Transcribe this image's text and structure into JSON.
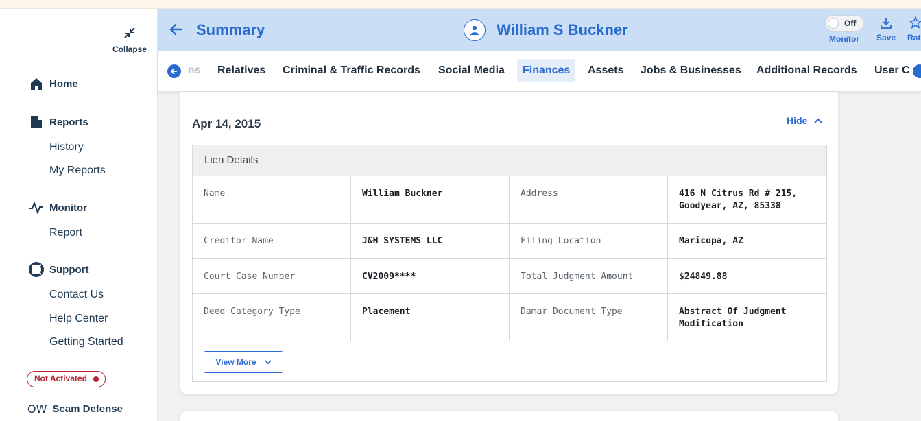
{
  "sidebar": {
    "collapse_label": "Collapse",
    "home": "Home",
    "reports": "Reports",
    "history": "History",
    "my_reports": "My Reports",
    "monitor": "Monitor",
    "report": "Report",
    "support": "Support",
    "contact_us": "Contact Us",
    "help_center": "Help Center",
    "getting_started": "Getting Started",
    "status_badge": "Not Activated",
    "scam_logo": "OW",
    "scam_defense": "Scam Defense"
  },
  "header": {
    "title": "Summary",
    "person_name": "William S Buckner",
    "toggle_state": "Off",
    "monitor_label": "Monitor",
    "save_label": "Save",
    "rate_label": "Rat"
  },
  "tabs": [
    {
      "label": "ns"
    },
    {
      "label": "Relatives"
    },
    {
      "label": "Criminal & Traffic Records"
    },
    {
      "label": "Social Media"
    },
    {
      "label": "Finances"
    },
    {
      "label": "Assets"
    },
    {
      "label": "Jobs & Businesses"
    },
    {
      "label": "Additional Records"
    },
    {
      "label": "User C"
    }
  ],
  "card": {
    "date": "Apr 14, 2015",
    "hide_label": "Hide",
    "section_title": "Lien Details",
    "rows": [
      [
        "Name",
        "William Buckner",
        "Address",
        "416 N Citrus Rd # 215, Goodyear, AZ, 85338"
      ],
      [
        "Creditor Name",
        "J&H SYSTEMS LLC",
        "Filing Location",
        "Maricopa, AZ"
      ],
      [
        "Court Case Number",
        "CV2009****",
        "Total Judgment Amount",
        "$24849.88"
      ],
      [
        "Deed Category Type",
        "Placement",
        "Damar Document Type",
        "Abstract Of Judgment Modification"
      ]
    ],
    "view_more": "View More"
  },
  "colors": {
    "accent": "#2a6bd0",
    "header_bg": "#cadef5",
    "alert": "#b3262f",
    "navy": "#1f3a52"
  },
  "icons": [
    "collapse-icon",
    "home-icon",
    "document-icon",
    "pulse-icon",
    "lifebuoy-icon",
    "back-arrow-icon",
    "user-icon",
    "download-icon",
    "star-icon",
    "chevron-up-icon",
    "chevron-down-icon"
  ]
}
